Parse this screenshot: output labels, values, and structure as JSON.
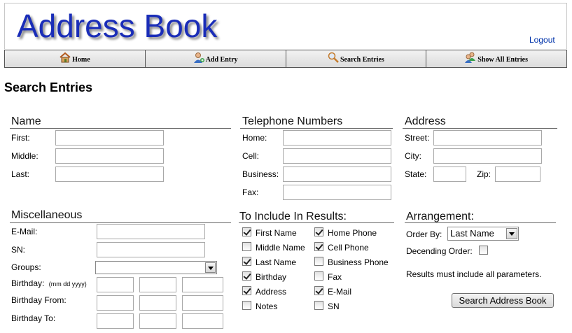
{
  "header": {
    "title": "Address Book",
    "logout": "Logout"
  },
  "nav": [
    {
      "label": "Home",
      "icon": "home-icon"
    },
    {
      "label": "Add Entry",
      "icon": "add-user-icon"
    },
    {
      "label": "Search Entries",
      "icon": "magnifier-icon"
    },
    {
      "label": "Show All Entries",
      "icon": "users-icon"
    }
  ],
  "page_title": "Search Entries",
  "name": {
    "title": "Name",
    "first": "First:",
    "middle": "Middle:",
    "last": "Last:"
  },
  "phones": {
    "title": "Telephone Numbers",
    "home": "Home:",
    "cell": "Cell:",
    "business": "Business:",
    "fax": "Fax:"
  },
  "address": {
    "title": "Address",
    "street": "Street:",
    "city": "City:",
    "state": "State:",
    "zip": "Zip:"
  },
  "misc": {
    "title": "Miscellaneous",
    "email": "E-Mail:",
    "sn": "SN:",
    "groups": "Groups:",
    "groups_value": "",
    "birthday": "Birthday:",
    "birthday_hint": "(mm dd yyyy)",
    "birthday_from": "Birthday From:",
    "birthday_to": "Birthday To:"
  },
  "include": {
    "title": "To Include In Results:",
    "left": [
      {
        "label": "First Name",
        "checked": true
      },
      {
        "label": "Middle Name",
        "checked": false
      },
      {
        "label": "Last Name",
        "checked": true
      },
      {
        "label": "Birthday",
        "checked": true
      },
      {
        "label": "Address",
        "checked": true
      },
      {
        "label": "Notes",
        "checked": false
      }
    ],
    "right": [
      {
        "label": "Home Phone",
        "checked": true
      },
      {
        "label": "Cell Phone",
        "checked": true
      },
      {
        "label": "Business Phone",
        "checked": false
      },
      {
        "label": "Fax",
        "checked": false
      },
      {
        "label": "E-Mail",
        "checked": true
      },
      {
        "label": "SN",
        "checked": false
      }
    ]
  },
  "arrangement": {
    "title": "Arrangement:",
    "order_by": "Order By:",
    "order_by_value": "Last Name",
    "descending": "Decending Order:",
    "descending_checked": false,
    "note": "Results must include all parameters.",
    "submit": "Search Address Book"
  },
  "colors": {
    "title": "#1a2db8",
    "link": "#0033aa"
  }
}
